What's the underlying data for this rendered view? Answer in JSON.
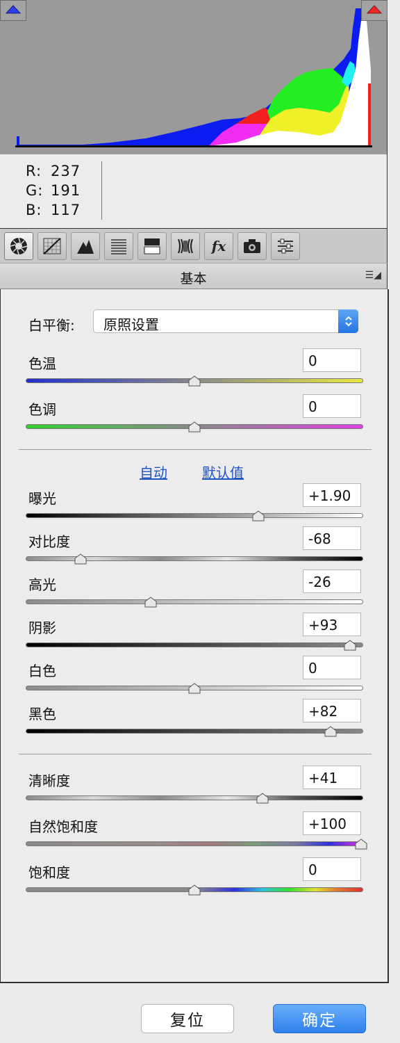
{
  "histogram": {
    "shadow_clip_icon": "blue-up-triangle",
    "highlight_clip_icon": "red-up-triangle"
  },
  "readout": {
    "r_label": "R:",
    "r_value": "237",
    "g_label": "G:",
    "g_value": "191",
    "b_label": "B:",
    "b_value": "117"
  },
  "toolbar": {
    "tools": [
      "basic-icon",
      "tone-curve-icon",
      "detail-icon",
      "hsl-icon",
      "split-toning-icon",
      "lens-corrections-icon",
      "effects-fx-icon",
      "camera-calibration-icon",
      "presets-icon"
    ],
    "fx_text": "fx"
  },
  "panel": {
    "title": "基本",
    "menu_glyph": "☰◢"
  },
  "white_balance": {
    "label": "白平衡:",
    "selected": "原照设置"
  },
  "sliders_wb": [
    {
      "label": "色温",
      "value": "0"
    },
    {
      "label": "色调",
      "value": "0"
    }
  ],
  "links": {
    "auto": "自动",
    "default": "默认值"
  },
  "sliders_tone": [
    {
      "label": "曝光",
      "value": "+1.90"
    },
    {
      "label": "对比度",
      "value": "-68"
    },
    {
      "label": "高光",
      "value": "-26"
    },
    {
      "label": "阴影",
      "value": "+93"
    },
    {
      "label": "白色",
      "value": "0"
    },
    {
      "label": "黑色",
      "value": "+82"
    }
  ],
  "sliders_presence": [
    {
      "label": "清晰度",
      "value": "+41"
    },
    {
      "label": "自然饱和度",
      "value": "+100"
    },
    {
      "label": "饱和度",
      "value": "0"
    }
  ],
  "buttons": {
    "reset": "复位",
    "ok": "确定"
  },
  "colors": {
    "accent": "#2f80ec",
    "link": "#2255c4"
  }
}
